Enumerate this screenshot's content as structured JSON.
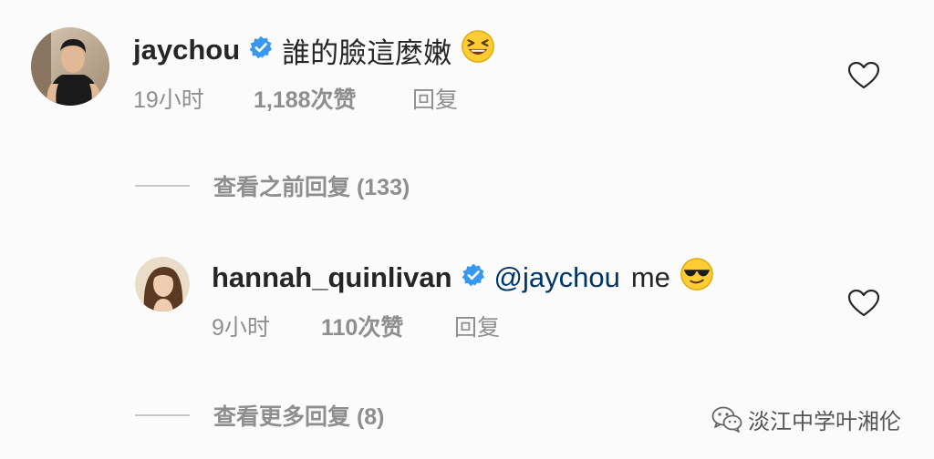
{
  "comments": [
    {
      "username": "jaychou",
      "text": "誰的臉這麼嫩",
      "emoji": "laughing-squint-emoji",
      "time": "19小时",
      "likes": "1,188次赞",
      "reply_label": "回复",
      "avatar": "profile photo of man in black tank top"
    },
    {
      "username": "hannah_quinlivan",
      "mention": "@jaychou",
      "text": "me",
      "emoji": "sunglasses-emoji",
      "time": "9小时",
      "likes": "110次赞",
      "reply_label": "回复",
      "avatar": "profile photo of woman with long hair"
    }
  ],
  "view_previous_replies": "查看之前回复 (133)",
  "view_more_replies": "查看更多回复 (8)",
  "watermark": {
    "text": "淡江中学叶湘伦",
    "icon": "wechat-icon"
  },
  "colors": {
    "background": "#fbfbfb",
    "text": "#262626",
    "secondary_text": "#8e8e8e",
    "verified_badge": "#3897f0",
    "mention": "#003569"
  }
}
